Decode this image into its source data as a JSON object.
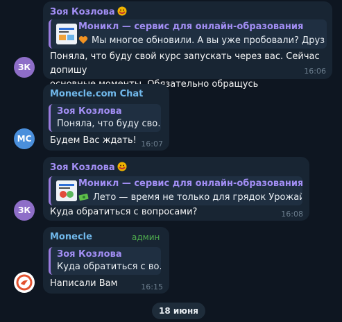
{
  "messages": [
    {
      "avatar_initials": "ЗК",
      "avatar_color": "#8e6ec8",
      "sender": "Зоя Козлова",
      "sender_color": "#a28ef4",
      "quote_title": "Моникл — сервис для онлайн-образования",
      "quote_text": "Мы многое обновили. А вы уже пробовали?  Друз…",
      "quote_emoji": "orange-heart-icon",
      "text_lines": [
        "Поняла, что буду свой курс запускать через вас. Сейчас допишу",
        "основные моменты. Обязательно обращусь"
      ],
      "time": "16:06"
    },
    {
      "avatar_initials": "MC",
      "avatar_color": "#4a8fdc",
      "sender": "Monecle.com Chat",
      "sender_color": "#71b9ec",
      "quote_title": "Зоя Козлова",
      "quote_text": "Поняла, что буду сво…",
      "text_lines": [
        "Будем Вас ждать!"
      ],
      "time": "16:07"
    },
    {
      "avatar_initials": "ЗК",
      "avatar_color": "#8e6ec8",
      "sender": "Зоя Козлова",
      "sender_color": "#a28ef4",
      "quote_title": "Моникл — сервис для онлайн-образования",
      "quote_text": "Лето — время не только для грядок Урожай …",
      "quote_emoji": "money-icon",
      "text_lines": [
        "Куда обратиться с вопросами?"
      ],
      "time": "16:08"
    },
    {
      "avatar_initials": "",
      "avatar_color": "#ffffff",
      "sender": "Monecle",
      "sender_color": "#71b9ec",
      "badge": "админ",
      "quote_title": "Зоя Козлова",
      "quote_text": "Куда обратиться с во…",
      "text_lines": [
        "Написали Вам"
      ],
      "time": "16:15"
    }
  ],
  "date_divider": "18 июня"
}
